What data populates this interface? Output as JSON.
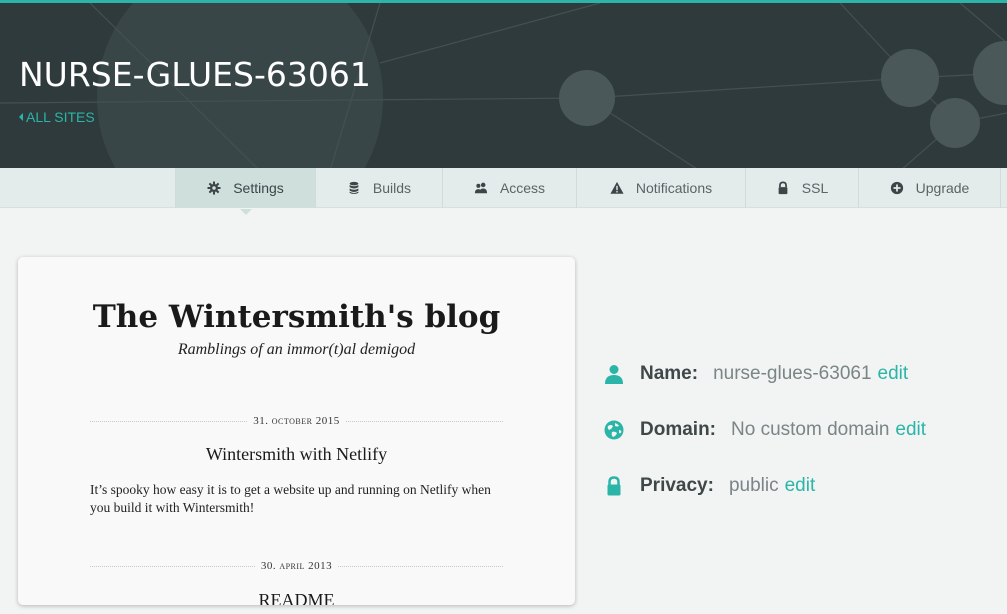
{
  "header": {
    "site_name": "NURSE-GLUES-63061",
    "back_link": "ALL SITES"
  },
  "tabs": [
    {
      "label": "Settings",
      "icon": "gear-icon"
    },
    {
      "label": "Builds",
      "icon": "database-icon"
    },
    {
      "label": "Access",
      "icon": "users-icon"
    },
    {
      "label": "Notifications",
      "icon": "warning-icon"
    },
    {
      "label": "SSL",
      "icon": "lock-icon"
    },
    {
      "label": "Upgrade",
      "icon": "plus-circle-icon"
    }
  ],
  "preview": {
    "blog_title": "The Wintersmith's blog",
    "blog_subtitle": "Ramblings of an immor(t)al demigod",
    "posts": [
      {
        "date": "31. october 2015",
        "title": "Wintersmith with Netlify",
        "excerpt": "It’s spooky how easy it is to get a website up and running on Netlify when you build it with Wintersmith!"
      },
      {
        "date": "30. april 2013",
        "title": "README"
      }
    ]
  },
  "info": {
    "name": {
      "label": "Name:",
      "value": "nurse-glues-63061",
      "edit": "edit",
      "icon": "user-icon"
    },
    "domain": {
      "label": "Domain:",
      "value": "No custom domain",
      "edit": "edit",
      "icon": "globe-icon"
    },
    "privacy": {
      "label": "Privacy:",
      "value": "public",
      "edit": "edit",
      "icon": "lock-icon"
    }
  },
  "colors": {
    "accent": "#2bb5a8",
    "header_bg": "#2f3a3c",
    "page_bg": "#f1f4f3"
  }
}
